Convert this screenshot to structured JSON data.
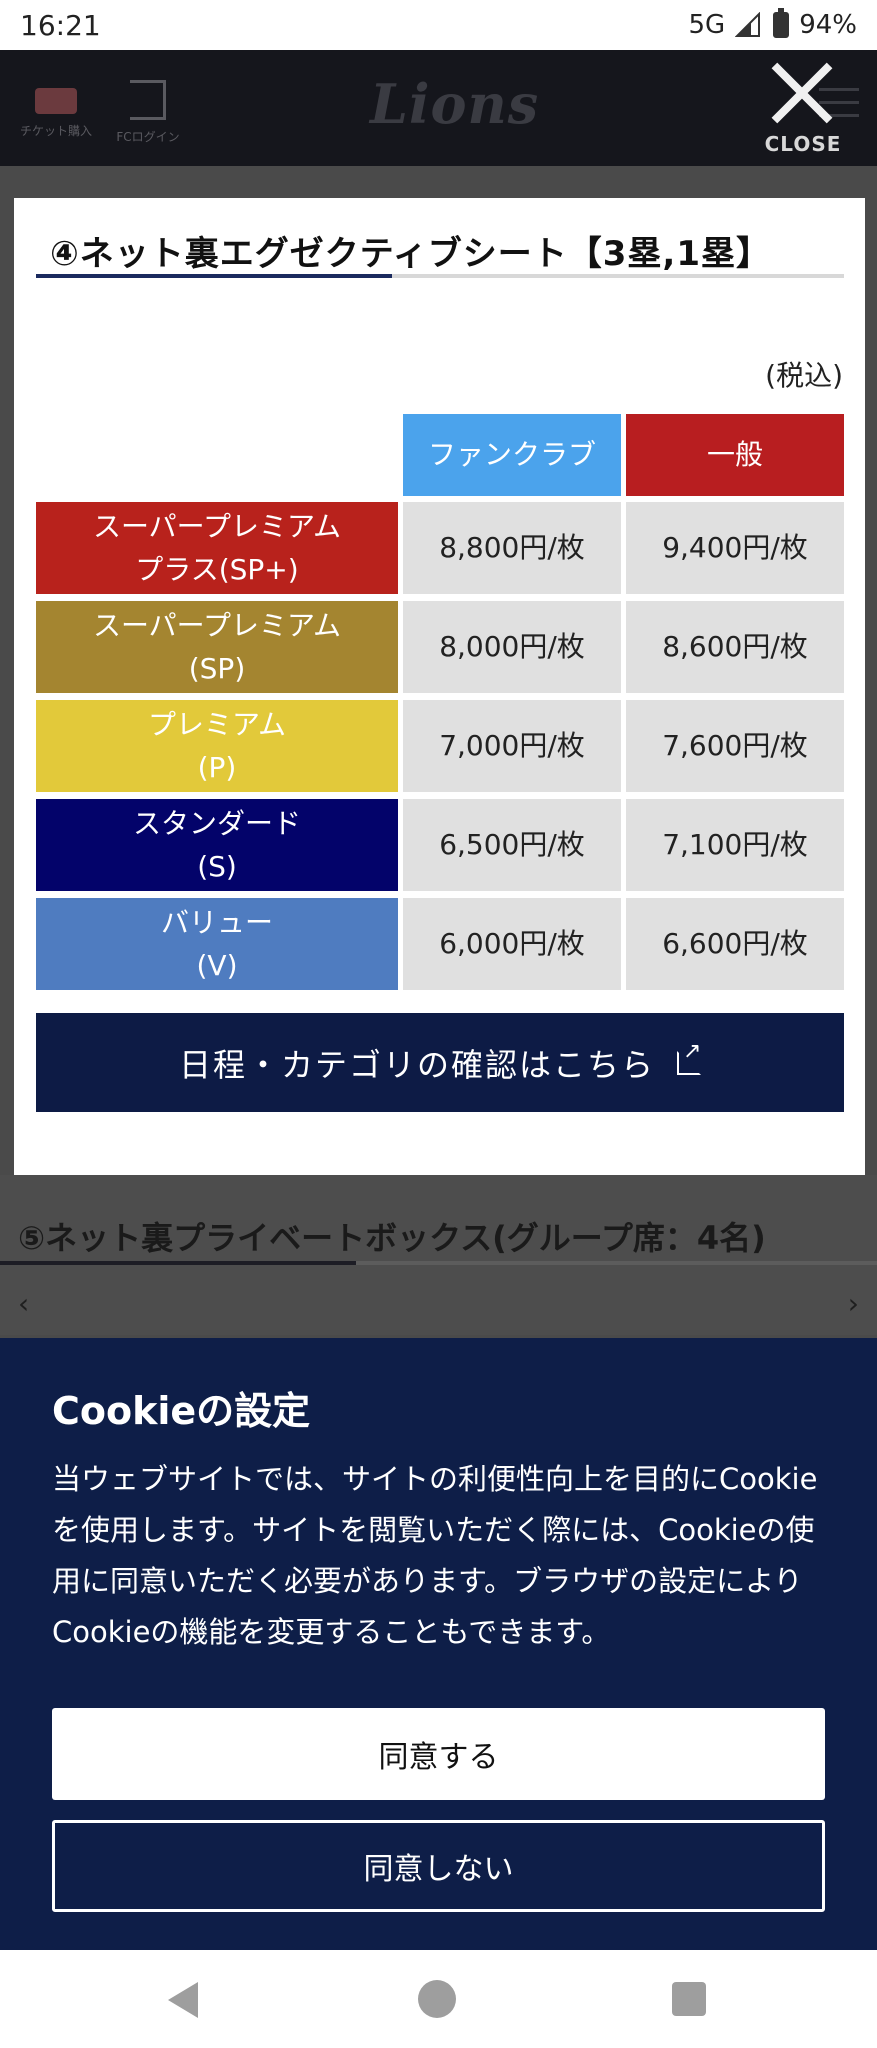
{
  "status_bar": {
    "time": "16:21",
    "network": "5G",
    "battery": "94%"
  },
  "header": {
    "ticket_label": "チケット購入",
    "fc_login_label": "FCログイン",
    "logo_text": "Lions",
    "close_label": "CLOSE"
  },
  "modal": {
    "title": "④ネット裏エグゼクティブシート【3塁,1塁】",
    "tax_note": "(税込)",
    "columns": [
      "ファンクラブ",
      "一般"
    ],
    "rows": [
      {
        "line1": "スーパープレミアム",
        "line2": "プラス(SP+)",
        "fan": "8,800円/枚",
        "general": "9,400円/枚",
        "color": "#b8221c"
      },
      {
        "line1": "スーパープレミアム",
        "line2": "(SP)",
        "fan": "8,000円/枚",
        "general": "8,600円/枚",
        "color": "#a48530"
      },
      {
        "line1": "プレミアム",
        "line2": "(P)",
        "fan": "7,000円/枚",
        "general": "7,600円/枚",
        "color": "#e2c93a"
      },
      {
        "line1": "スタンダード",
        "line2": "(S)",
        "fan": "6,500円/枚",
        "general": "7,100円/枚",
        "color": "#03036a"
      },
      {
        "line1": "バリュー",
        "line2": "(V)",
        "fan": "6,000円/枚",
        "general": "6,600円/枚",
        "color": "#4f7cc0"
      }
    ],
    "schedule_button": "日程・カテゴリの確認はこちら"
  },
  "next_section": {
    "title": "⑤ネット裏プライベートボックス(グループ席：4名)"
  },
  "cookie": {
    "title": "Cookieの設定",
    "lines": [
      "当ウェブサイトでは、サイトの利便性向上を目的にCookie",
      "を使用します。サイトを閲覧いただく際には、Cookieの使",
      "用に同意いただく必要があります。ブラウザの設定により",
      "Cookieの機能を変更することもできます。"
    ],
    "agree_label": "同意する",
    "disagree_label": "同意しない"
  }
}
